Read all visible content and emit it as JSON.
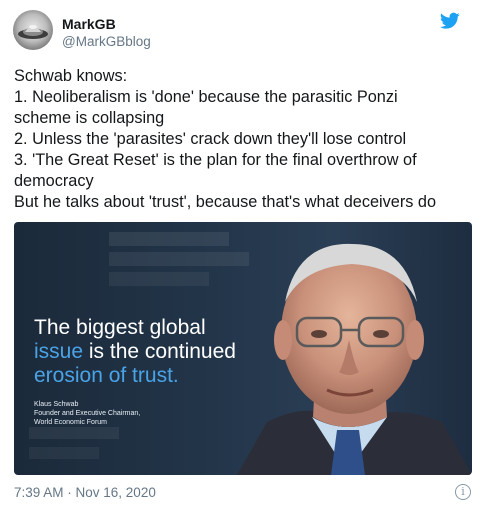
{
  "author": {
    "name": "MarkGB",
    "handle": "@MarkGBblog",
    "avatar_icon": "profile-avatar-icon"
  },
  "brand": {
    "icon": "twitter-bird-icon",
    "color": "#1da1f2"
  },
  "tweet": {
    "lines": [
      "Schwab knows:",
      "1. Neoliberalism is 'done' because the parasitic Ponzi",
      "scheme is collapsing",
      "2. Unless the 'parasites' crack down they'll lose control",
      "3. 'The Great Reset' is the plan for the final overthrow of",
      "democracy",
      "But he talks about 'trust', because that's what deceivers do"
    ]
  },
  "media": {
    "quote_line1": "The biggest global",
    "quote_line2_highlight": "issue",
    "quote_line2_rest": " is the continued",
    "quote_line3": "erosion of trust.",
    "credit_name": "Klaus Schwab",
    "credit_title": "Founder and Executive Chairman,",
    "credit_org": "World Economic Forum",
    "highlight_color": "#4aa3e6"
  },
  "footer": {
    "timestamp": "7:39 AM · Nov 16, 2020",
    "info_icon": "info-icon",
    "info_glyph": "i"
  }
}
